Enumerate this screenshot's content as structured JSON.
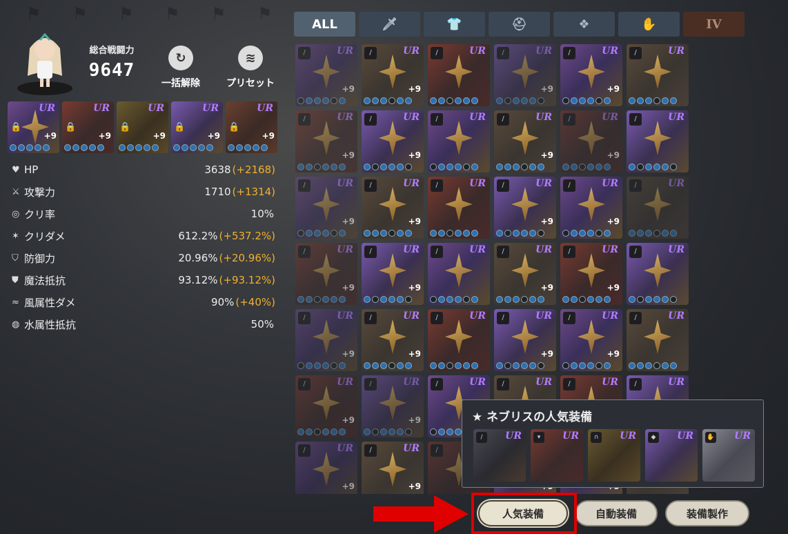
{
  "header": {
    "power_label": "総合戦闘力",
    "power_value": "9647",
    "unequip_all_label": "一括解除",
    "preset_label": "プリセット"
  },
  "stats": [
    {
      "icon": "heart-icon",
      "name": "HP",
      "value": "3638",
      "bonus": "(+2168)"
    },
    {
      "icon": "sword-icon",
      "name": "攻撃力",
      "value": "1710",
      "bonus": "(+1314)"
    },
    {
      "icon": "target-icon",
      "name": "クリ率",
      "value": "10%",
      "bonus": ""
    },
    {
      "icon": "burst-icon",
      "name": "クリダメ",
      "value": "612.2%",
      "bonus": "(+537.2%)"
    },
    {
      "icon": "shield-icon",
      "name": "防御力",
      "value": "20.96%",
      "bonus": "(+20.96%)"
    },
    {
      "icon": "magic-shield-icon",
      "name": "魔法抵抗",
      "value": "93.12%",
      "bonus": "(+93.12%)"
    },
    {
      "icon": "wind-icon",
      "name": "風属性ダメ",
      "value": "90%",
      "bonus": "(+40%)"
    },
    {
      "icon": "water-icon",
      "name": "水属性抵抗",
      "value": "50%",
      "bonus": ""
    }
  ],
  "tabs": [
    {
      "label": "ALL",
      "icon": "",
      "active": true
    },
    {
      "label": "",
      "icon": "sword-icon",
      "active": false
    },
    {
      "label": "",
      "icon": "armor-icon",
      "active": false
    },
    {
      "label": "",
      "icon": "helmet-icon",
      "active": false
    },
    {
      "label": "",
      "icon": "amulet-icon",
      "active": false
    },
    {
      "label": "",
      "icon": "glove-icon",
      "active": false
    },
    {
      "label": "IV",
      "icon": "",
      "active": false
    }
  ],
  "rarity_label": "UR",
  "enhance_label": "+9",
  "popup": {
    "title": "★ ネブリスの人気装備"
  },
  "buttons": {
    "popular": "人気装備",
    "auto": "自動装備",
    "craft": "装備製作"
  },
  "colors": {
    "accent_orange": "#f0b030",
    "highlight_red": "#e00000",
    "rarity_purple": "#b07cff"
  }
}
